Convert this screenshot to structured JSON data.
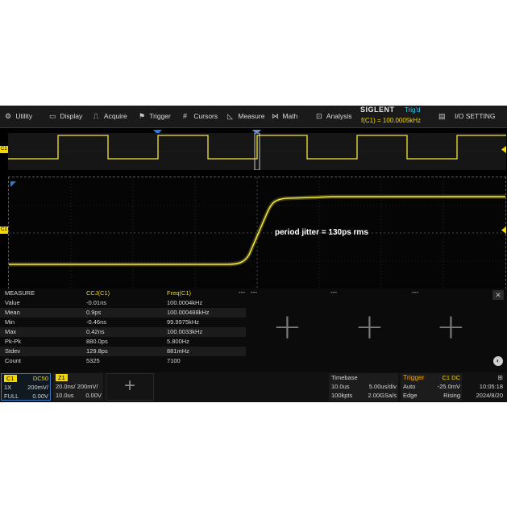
{
  "menu": {
    "items": [
      {
        "icon": "gear-icon",
        "glyph": "⚙",
        "label": "Utility"
      },
      {
        "icon": "display-icon",
        "glyph": "▭",
        "label": "Display"
      },
      {
        "icon": "acquire-icon",
        "glyph": "⎍",
        "label": "Acquire"
      },
      {
        "icon": "trigger-icon",
        "glyph": "⚑",
        "label": "Trigger"
      },
      {
        "icon": "cursors-icon",
        "glyph": "#",
        "label": "Cursors"
      },
      {
        "icon": "measure-icon",
        "glyph": "◺",
        "label": "Measure"
      },
      {
        "icon": "math-icon",
        "glyph": "⋈",
        "label": "Math"
      },
      {
        "icon": "analysis-icon",
        "glyph": "⊡",
        "label": "Analysis"
      }
    ],
    "brand": "SIGLENT",
    "status": "Trig'd",
    "frequency": "f(C1) = 100.0005kHz",
    "io_label": "I/O SETTING"
  },
  "waveform": {
    "channel_marker": "C1",
    "annotation": "period jitter = 130ps rms",
    "trace_color": "#f5e642"
  },
  "measure": {
    "title": "MEASURE",
    "col1": "CCJ(C1)",
    "col2": "Freq(C1)",
    "ellipsis": "---",
    "rows": [
      {
        "label": "Value",
        "v1": "-0.01ns",
        "v2": "100.0004kHz"
      },
      {
        "label": "Mean",
        "v1": "0.9ps",
        "v2": "100.000488kHz"
      },
      {
        "label": "Min",
        "v1": "-0.46ns",
        "v2": "99.9975kHz"
      },
      {
        "label": "Max",
        "v1": "0.42ns",
        "v2": "100.0033kHz"
      },
      {
        "label": "Pk-Pk",
        "v1": "880.0ps",
        "v2": "5.800Hz"
      },
      {
        "label": "Stdev",
        "v1": "129.8ps",
        "v2": "881mHz"
      },
      {
        "label": "Count",
        "v1": "5325",
        "v2": "7100"
      }
    ]
  },
  "channel": {
    "tag": "C1",
    "coupling": "DC50",
    "probe": "1X",
    "scale": "200mV/",
    "bandwidth": "FULL",
    "offset": "0.00V"
  },
  "zoom": {
    "tag": "Z1",
    "line1": "20.0ns/ 200mV/",
    "time": "10.0us",
    "offset": "0.00V"
  },
  "timebase": {
    "title": "Timebase",
    "delay": "10.0us",
    "scale": "5.00us/div",
    "points": "100kpts",
    "rate": "2.00GSa/s"
  },
  "trigger": {
    "title": "Trigger",
    "source": "C1 DC",
    "mode": "Auto",
    "level": "-25.0mV",
    "type": "Edge",
    "slope": "Rising"
  },
  "clock": {
    "time": "10:05:18",
    "date": "2024/8/20"
  }
}
